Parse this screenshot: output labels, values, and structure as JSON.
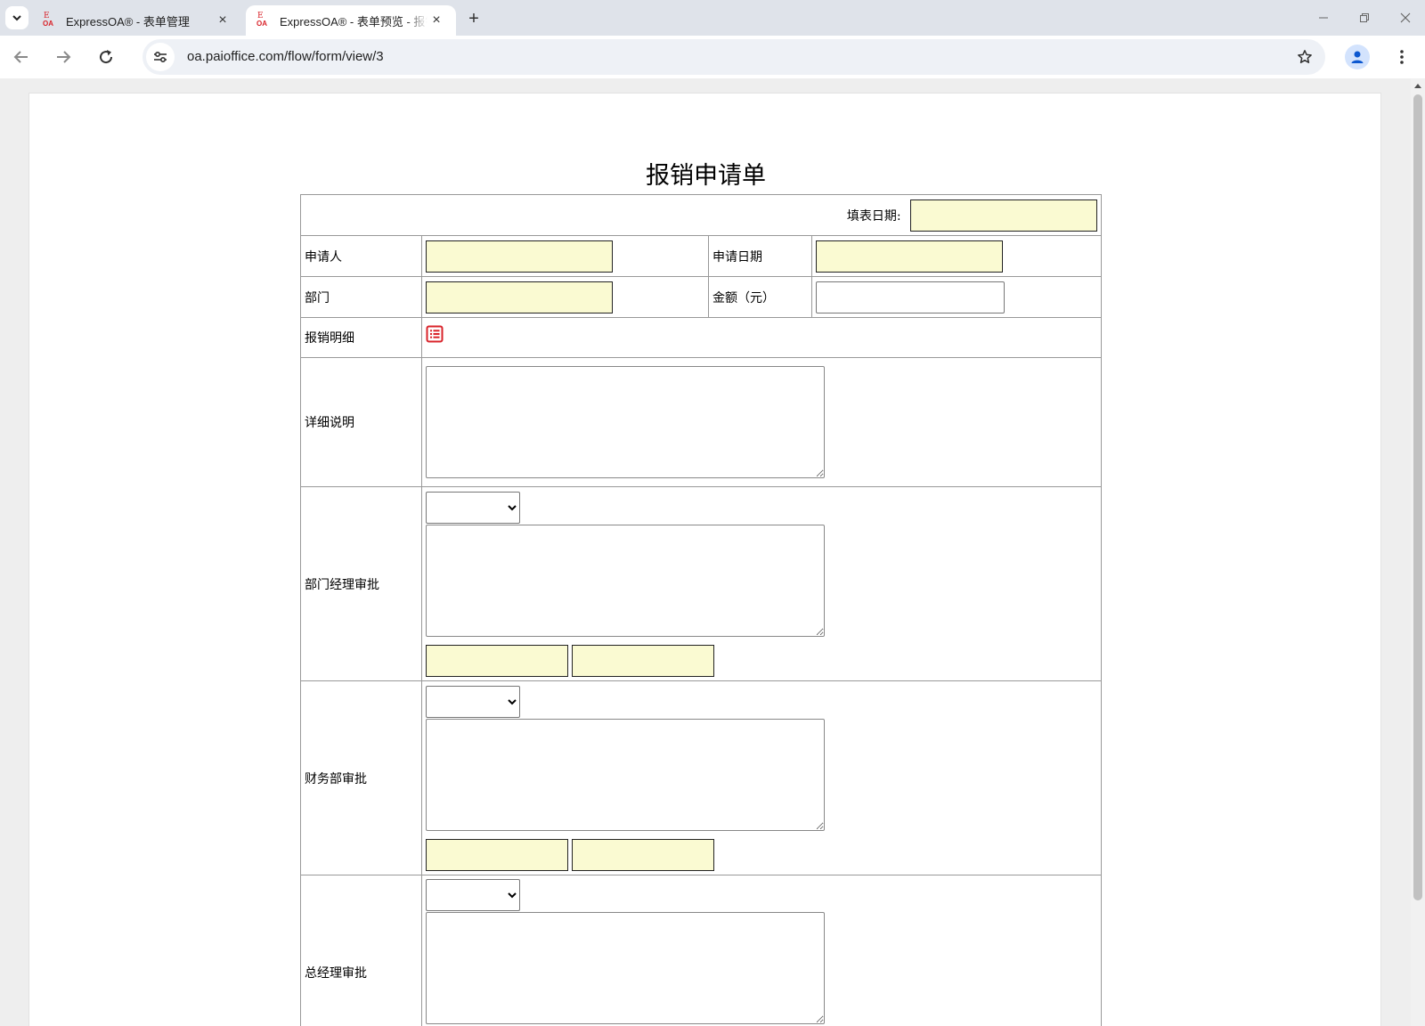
{
  "browser": {
    "tabs": [
      {
        "title": "ExpressOA® - 表单管理",
        "active": false
      },
      {
        "title": "ExpressOA® - 表单预览 - 报销申请单",
        "active": true
      }
    ],
    "url": "oa.paioffice.com/flow/form/view/3",
    "favicon_top": "E",
    "favicon_bottom": "OA",
    "new_tab_symbol": "+",
    "close_symbol": "×"
  },
  "form": {
    "title": "报销申请单",
    "fill_date_label": "填表日期:",
    "applicant_label": "申请人",
    "apply_date_label": "申请日期",
    "department_label": "部门",
    "amount_label": "金额（元）",
    "detail_list_label": "报销明细",
    "description_label": "详细说明",
    "dept_manager_label": "部门经理审批",
    "finance_label": "财务部审批",
    "general_manager_label": "总经理审批"
  },
  "colors": {
    "field_fill": "#fafad2",
    "accent_red": "#d9232a"
  }
}
